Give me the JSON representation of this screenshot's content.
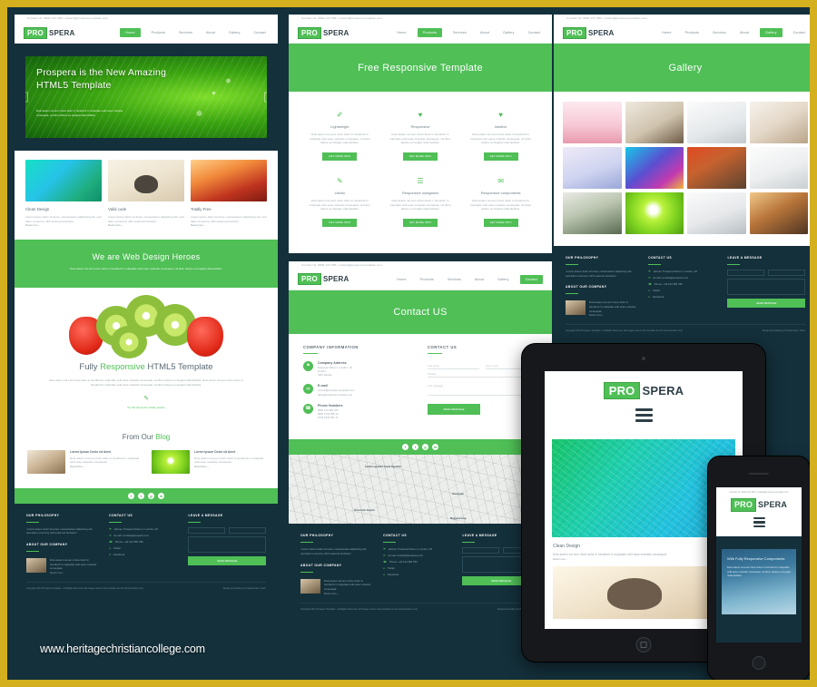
{
  "watermark": "www.heritagechristiancollege.com",
  "brand": {
    "pro": "PRO",
    "spera": "SPERA",
    "topbar": "Contact Us: 0800 123 456   |   contact@prospera-template.com"
  },
  "nav": {
    "home": "Home",
    "products": "Products",
    "services": "Services",
    "about": "About",
    "gallery": "Gallery",
    "contact": "Contact"
  },
  "home": {
    "hero": {
      "title": "Prospera is the New Amazing HTML5 Template",
      "text": "Duis autem vel eum iriure dolor in hendrerit in vulputate velit esse molestie consequat, vel illum dolore eu feugiat nulla facilisis.",
      "prev": "‹",
      "next": "›"
    },
    "cards": [
      {
        "title": "Clean Design",
        "text": "Lorem ipsum dolor sit amet, consectetuer adipiscing elit, sed diam nonummy nibh euismod tincidunt.",
        "more": "Read more ›"
      },
      {
        "title": "Valid code",
        "text": "Lorem ipsum dolor sit amet, consectetuer adipiscing elit, sed diam nonummy nibh euismod tincidunt.",
        "more": "Read more ›"
      },
      {
        "title": "Totally Free",
        "text": "Lorem ipsum dolor sit amet, consectetuer adipiscing elit, sed diam nonummy nibh euismod tincidunt.",
        "more": "Read more ›"
      }
    ],
    "heroes": {
      "title": "We are Web Design Heroes",
      "text": "Duis autem vel eum iriure dolor in hendrerit in vulputate velit esse molestie consequat, vel illum dolore eu feugiat nulla facilisis."
    },
    "responsive": {
      "title_1": "Fully ",
      "title_2": "Responsive",
      "title_3": " HTML5 Template",
      "text": "Duis autem vel eum iriure dolor in hendrerit in vulputate velit esse molestie consequat, vel illum dolore eu feugiat nulla facilisis. Duis autem vel eum iriure dolor in hendrerit in vulputate velit esse molestie consequat, vel illum dolore eu feugiat nulla facilisis.",
      "icon": "pencil-icon",
      "link": "Try this theme for mobile version"
    },
    "blog": {
      "title_1": "From Our ",
      "title_2": "Blog",
      "posts": [
        {
          "title": "Lorem Ipsum Dolor sit Amet",
          "text": "Duis autem vel eum iriure dolor in hendrerit in vulputate velit esse molestie consequat.",
          "more": "Read More ›"
        },
        {
          "title": "Lorem Ipsum Dolor sit Amet",
          "text": "Duis autem vel eum iriure dolor in hendrerit in vulputate velit esse molestie consequat.",
          "more": "Read More ›"
        }
      ]
    }
  },
  "social": [
    "f",
    "t",
    "g",
    "in"
  ],
  "footer": {
    "philosophy_title": "OUR PHILOSOPHY",
    "philosophy_text": "“Lorem ipsum dolor sit amet, consectetuer adipiscing elit, sed diam nonummy nibh euismod tincidunt.”",
    "about_title": "ABOUT OUR COMPANY",
    "about_text": "Duis autem vel eum iriure dolor in hendrerit in vulputate velit esse molestie consequat.",
    "about_more": "Read more ›",
    "contact_title": "CONTACT US",
    "contact_items": [
      "Adress: Prospera Street 1, London, UK",
      "E-mail: contact@prospera.com",
      "Phone: +44 123 456 789",
      "Twitter",
      "Facebook"
    ],
    "message_title": "LEAVE A MESSAGE",
    "field_name": "Your name",
    "field_email": "Your e-mail",
    "field_message": "Your message",
    "send_button": "SEND MESSAGE",
    "copyright": "Copyright 2014 Prospera Template - All Rights Reserved. All images used in this template are for demonstration only.",
    "credit": "Design and coding by Prospera Dev. Team"
  },
  "products": {
    "page_title": "Free Responsive Template",
    "features": [
      {
        "icon": "feather-icon",
        "glyph": "✐",
        "title": "Lightweight",
        "text": "Duis autem vel eum iriure dolor in hendrerit in vulputate velit esse molestie consequat, vel illum dolore eu feugiat nulla facilisis.",
        "button": "GET MORE INFO"
      },
      {
        "icon": "heart-icon",
        "glyph": "♥",
        "title": "Responsive",
        "text": "Duis autem vel eum iriure dolor in hendrerit in vulputate velit esse molestie consequat, vel illum dolore eu feugiat nulla facilisis.",
        "button": "GET MORE INFO"
      },
      {
        "icon": "heart-icon",
        "glyph": "♥",
        "title": "Intuitive",
        "text": "Duis autem vel eum iriure dolor in hendrerit in vulputate velit esse molestie consequat, vel illum dolore eu feugiat nulla facilisis.",
        "button": "GET MORE INFO"
      },
      {
        "icon": "pencil-icon",
        "glyph": "✎",
        "title": "Useful",
        "text": "Duis autem vel eum iriure dolor in hendrerit in vulputate velit esse molestie consequat, vel illum dolore eu feugiat nulla facilisis.",
        "button": "GET MORE INFO"
      },
      {
        "icon": "menu-icon",
        "glyph": "☰",
        "title": "Responsive navigation",
        "text": "Duis autem vel eum iriure dolor in hendrerit in vulputate velit esse molestie consequat, vel illum dolore eu feugiat nulla facilisis.",
        "button": "GET MORE INFO"
      },
      {
        "icon": "mail-icon",
        "glyph": "✉",
        "title": "Responsive components",
        "text": "Duis autem vel eum iriure dolor in hendrerit in vulputate velit esse molestie consequat, vel illum dolore eu feugiat nulla facilisis.",
        "button": "GET MORE INFO"
      }
    ]
  },
  "contact": {
    "page_title": "Contact US",
    "info_title": "COMPANY INFORMATION",
    "form_title": "CONTACT US",
    "items": [
      {
        "icon": "location-icon",
        "glyph": "⚑",
        "title": "Company Address",
        "text": "Prospera Street 1, London, UK\nLondon\nSW1 Double"
      },
      {
        "icon": "mail-icon",
        "glyph": "✉",
        "title": "E-mail",
        "text": "contact@prospera-template.com\noffice@prospera-template.com"
      },
      {
        "icon": "phone-icon",
        "glyph": "☎",
        "title": "Phone Numbers",
        "text": "0800 123 456 789\n0800 1234 555 12\n0778 2345 561 72"
      }
    ],
    "field_name": "Your name",
    "field_email": "Your e-mail",
    "field_subject": "Subject",
    "field_message": "Your message",
    "send_button": "SEND MESSAGE",
    "map": {
      "labels": [
        "Česká republika\nCzech Republic",
        "Slovensko",
        "Österreich\nAustria",
        "Magyarország"
      ]
    }
  },
  "gallery": {
    "page_title": "Gallery",
    "images": [
      "pink-cityscape",
      "living-room-fireplace",
      "white-shelving",
      "hands-drawing-plans",
      "purple-desk",
      "colorful-abstract",
      "orange-red-lounge",
      "white-kitchen",
      "glass-door-room",
      "green-light-bulb",
      "restaurant-sketch",
      "man-at-table"
    ]
  },
  "tablet": {
    "title": "Clean Design",
    "text": "Duis autem vel eum iriure dolor in hendrerit in vulputate velit esse molestie consequat.",
    "more": "Read more ›"
  },
  "phone": {
    "title": "With Fully Responsive Components",
    "text": "Duis autem vel eum iriure dolor in hendrerit in vulputate velit esse molestie consequat, vel illum dolore eu feugiat nulla facilisis."
  },
  "colors": {
    "accent": "#4fbf56",
    "dark": "#14303b",
    "border": "#d4af1e"
  }
}
